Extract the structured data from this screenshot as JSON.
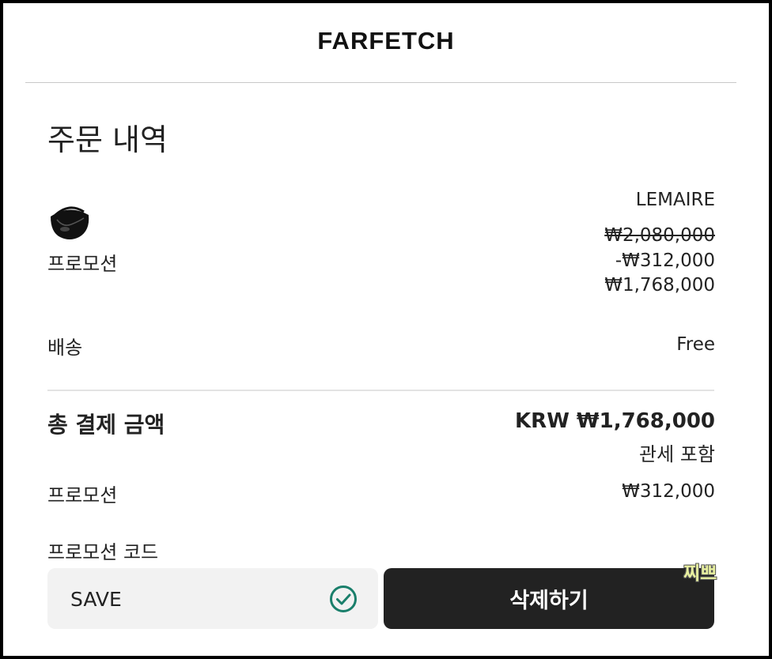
{
  "header": {
    "brand": "FARFETCH"
  },
  "order_summary": {
    "title": "주문 내역",
    "item": {
      "brand": "LEMAIRE",
      "image_icon": "bag-thumbnail-icon",
      "promo_label": "프로모션",
      "original_price": "₩2,080,000",
      "discount": "-₩312,000",
      "final_price": "₩1,768,000"
    },
    "shipping": {
      "label": "배송",
      "value": "Free"
    },
    "total": {
      "label": "총 결제 금액",
      "value": "KRW ₩1,768,000",
      "note": "관세 포함"
    },
    "promotion": {
      "label": "프로모션",
      "value": "₩312,000"
    },
    "promo_code": {
      "label": "프로모션 코드",
      "value": "SAVE",
      "status_icon": "check-circle-icon",
      "status_color": "#1a7f6b",
      "remove_label": "삭제하기"
    }
  },
  "watermark": "찌쁘"
}
